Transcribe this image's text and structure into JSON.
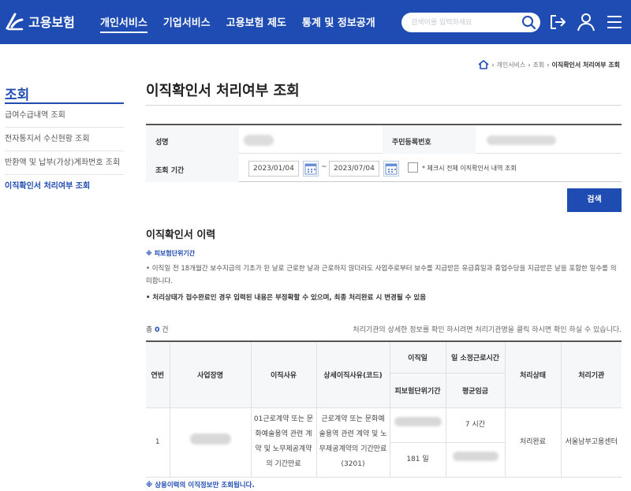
{
  "header": {
    "logo_text": "고용보험",
    "nav": [
      {
        "label": "개인서비스",
        "active": true
      },
      {
        "label": "기업서비스",
        "active": false
      },
      {
        "label": "고용보험 제도",
        "active": false
      },
      {
        "label": "통계 및 정보공개",
        "active": false
      }
    ],
    "search_placeholder": "검색어를 입력하세요",
    "brand_color": "#1f4cb3"
  },
  "breadcrumb": {
    "home_icon": "home-icon",
    "items": [
      "개인서비스",
      "조회",
      "이직확인서 처리여부 조회"
    ]
  },
  "sidebar": {
    "title": "조회",
    "items": [
      {
        "label": "급여수급내역 조회",
        "active": false
      },
      {
        "label": "전자통지서 수신현황 조회",
        "active": false
      },
      {
        "label": "반환액 및 납부(가상)계좌번호 조회",
        "active": false
      },
      {
        "label": "이직확인서 처리여부 조회",
        "active": true
      }
    ]
  },
  "page": {
    "title": "이직확인서 처리여부 조회"
  },
  "form": {
    "name_label": "성명",
    "rrn_label": "주민등록번호",
    "period_label": "조회 기간",
    "start_date": "2023/01/04",
    "tilde": "~",
    "end_date": "2023/07/04",
    "check_label": "* 체크시 전체 이직확인서 내역 조회",
    "search_button": "검색"
  },
  "history": {
    "title": "이직확인서 이력",
    "note_head": "※ 피보험단위기간",
    "note_text": "• 이직일 전 18개월간 보수지급의 기초가 된 날로 근로한 날과 근로하지 않더라도 사업주로부터 보수를 지급받은 유급휴일과 휴업수당을 지급받은 날을 포함한 일수를 의미합니다.",
    "note_bold": "• 처리상태가 접수완료인 경우 입력된 내용은 부정확할 수 있으며, 최종 처리완료 시 변경될 수 있음",
    "count_prefix": "총",
    "count_value": "0",
    "count_suffix": "건",
    "count_note": "처리기관의 상세한 정보를 확인 하시려면 처리기관명을 클릭 하시면 확인 하실 수 있습니다.",
    "columns": {
      "no": "연번",
      "company": "사업장명",
      "reason": "이직사유",
      "detail_reason": "상세이직사유(코드)",
      "leave_date": "이직일",
      "insured_period": "피보험단위기간",
      "work_hours": "일 소정근로시간",
      "avg_wage": "평균임금",
      "status": "처리상태",
      "agency": "처리기관"
    },
    "rows": [
      {
        "no": "1",
        "reason": "01근로계약 또는 문화예술용역 관련 계약 및 노무제공계약의 기간만료",
        "detail_reason": "근로계약 또는 문화예술용역 관련 계약 및 노무제공계약의 기간만료(3201)",
        "work_hours": "7 시간",
        "insured_period": "181 일",
        "status": "처리완료",
        "agency": "서울남부고용센터"
      }
    ],
    "foot_note": "※ 상용이력의 이직정보만 조회됩니다."
  }
}
